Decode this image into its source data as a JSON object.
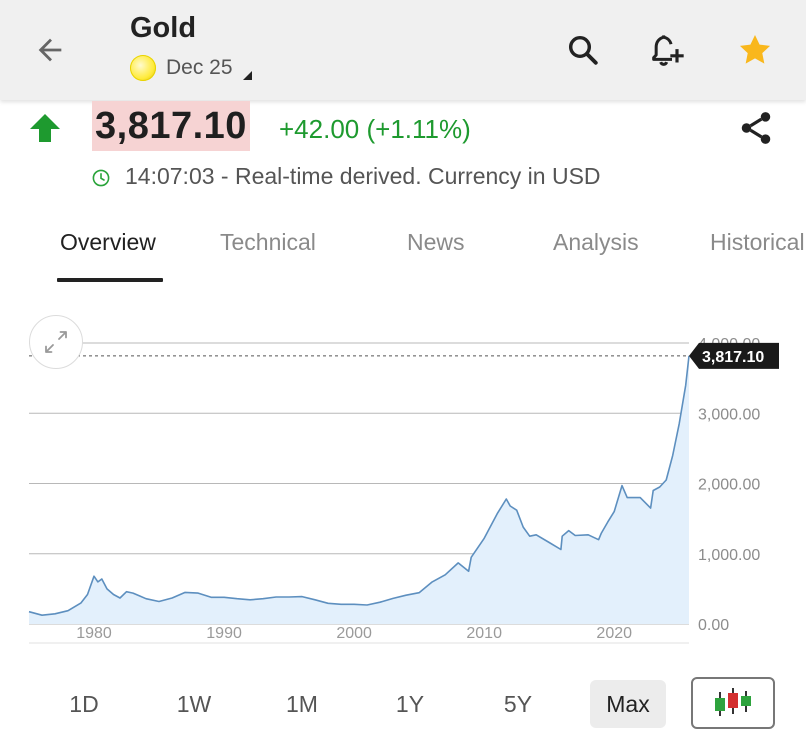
{
  "header": {
    "title": "Gold",
    "contract": "Dec 25",
    "icons": {
      "back": "back-arrow-icon",
      "search": "search-icon",
      "alert": "bell-plus-icon",
      "favorite": "star-icon"
    },
    "colors": {
      "star": "#f9b71c"
    }
  },
  "quote": {
    "price": "3,817.10",
    "change": "+42.00 (+1.11%)",
    "timestamp": "14:07:03 - Real-time derived. Currency in USD",
    "colors": {
      "up": "#1e9a2f",
      "price_highlight": "#f6d3d3"
    }
  },
  "tabs": [
    {
      "label": "Overview",
      "active": true
    },
    {
      "label": "Technical",
      "active": false
    },
    {
      "label": "News",
      "active": false
    },
    {
      "label": "Analysis",
      "active": false
    },
    {
      "label": "Historical",
      "active": false
    }
  ],
  "chart_data": {
    "type": "area",
    "title": "",
    "xlabel": "",
    "ylabel": "",
    "xlim": [
      1975,
      2025.75
    ],
    "ylim": [
      0,
      4000
    ],
    "x_ticks": [
      "1980",
      "1990",
      "2000",
      "2010",
      "2020"
    ],
    "y_ticks": [
      "4,000.00",
      "3,000.00",
      "2,000.00",
      "1,000.00",
      "0.00"
    ],
    "current_value": 3817.1,
    "current_label": "3,817.10",
    "grid": true,
    "colors": {
      "line": "#5d8fbf",
      "fill": "#e3f0fc",
      "label_bg": "#1a1a1a"
    },
    "series": [
      {
        "x": [
          1975,
          1976,
          1977,
          1978,
          1979,
          1979.5,
          1980,
          1980.3,
          1980.6,
          1981,
          1981.5,
          1982,
          1982.5,
          1983,
          1983.5,
          1984,
          1985,
          1986,
          1987,
          1988,
          1989,
          1990,
          1991,
          1992,
          1993,
          1994,
          1995,
          1996,
          1997,
          1998,
          1999,
          2000,
          2001,
          2002,
          2003,
          2004,
          2005,
          2006,
          2007,
          2008,
          2008.8,
          2009,
          2010,
          2011,
          2011.7,
          2012,
          2012.5,
          2013,
          2013.5,
          2014,
          2015,
          2015.9,
          2016,
          2016.5,
          2017,
          2018,
          2018.8,
          2019,
          2019.5,
          2020,
          2020.6,
          2021,
          2022,
          2022.8,
          2023,
          2023.5,
          2024,
          2024.5,
          2025,
          2025.5,
          2025.75
        ],
        "y": [
          175,
          125,
          145,
          190,
          300,
          420,
          680,
          600,
          640,
          500,
          420,
          370,
          460,
          440,
          400,
          360,
          320,
          370,
          450,
          440,
          380,
          380,
          360,
          345,
          360,
          385,
          385,
          390,
          345,
          295,
          280,
          280,
          270,
          310,
          365,
          410,
          445,
          600,
          700,
          870,
          750,
          950,
          1220,
          1570,
          1780,
          1680,
          1620,
          1380,
          1250,
          1270,
          1160,
          1060,
          1250,
          1330,
          1260,
          1270,
          1200,
          1290,
          1450,
          1600,
          1970,
          1800,
          1800,
          1650,
          1900,
          1950,
          2050,
          2400,
          2850,
          3400,
          3817.1
        ]
      }
    ]
  },
  "ranges": [
    {
      "label": "1D",
      "active": false
    },
    {
      "label": "1W",
      "active": false
    },
    {
      "label": "1M",
      "active": false
    },
    {
      "label": "1Y",
      "active": false
    },
    {
      "label": "5Y",
      "active": false
    },
    {
      "label": "Max",
      "active": true
    }
  ],
  "candle_toggle": {
    "icon": "candlestick-icon"
  }
}
